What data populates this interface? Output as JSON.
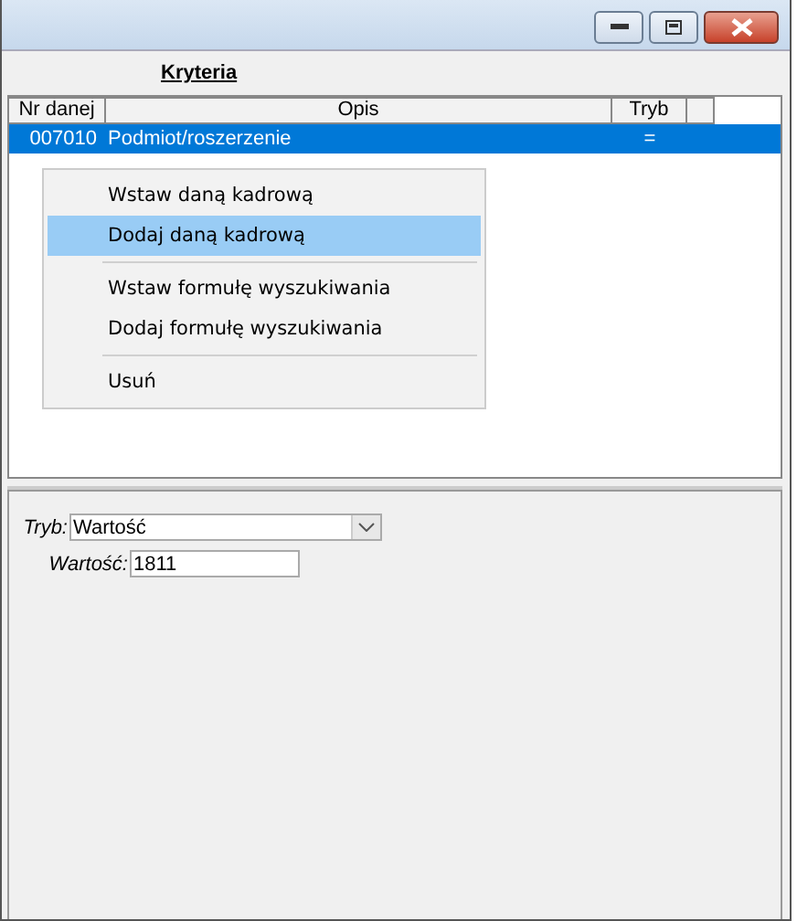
{
  "window": {
    "controls": [
      {
        "kind": "minimize"
      },
      {
        "kind": "maximize"
      },
      {
        "kind": "close"
      }
    ]
  },
  "section_title": "Kryteria",
  "table": {
    "columns": [
      "Nr danej",
      "Opis",
      "Tryb"
    ],
    "rows": [
      {
        "cells": [
          "007010",
          "Podmiot/roszerzenie",
          "="
        ],
        "selected": true
      }
    ]
  },
  "context_menu": [
    {
      "kind": "item",
      "label": "Wstaw daną kadrową",
      "selected": false
    },
    {
      "kind": "item",
      "label": "Dodaj daną kadrową",
      "selected": true
    },
    {
      "kind": "separator"
    },
    {
      "kind": "item",
      "label": "Wstaw formułę wyszukiwania",
      "selected": false
    },
    {
      "kind": "item",
      "label": "Dodaj formułę wyszukiwania",
      "selected": false
    },
    {
      "kind": "separator"
    },
    {
      "kind": "item",
      "label": "Usuń",
      "selected": false
    }
  ],
  "form": {
    "mode_label": "Tryb:",
    "mode_value": "Wartość",
    "value_label": "Wartość:",
    "value": "1811"
  }
}
